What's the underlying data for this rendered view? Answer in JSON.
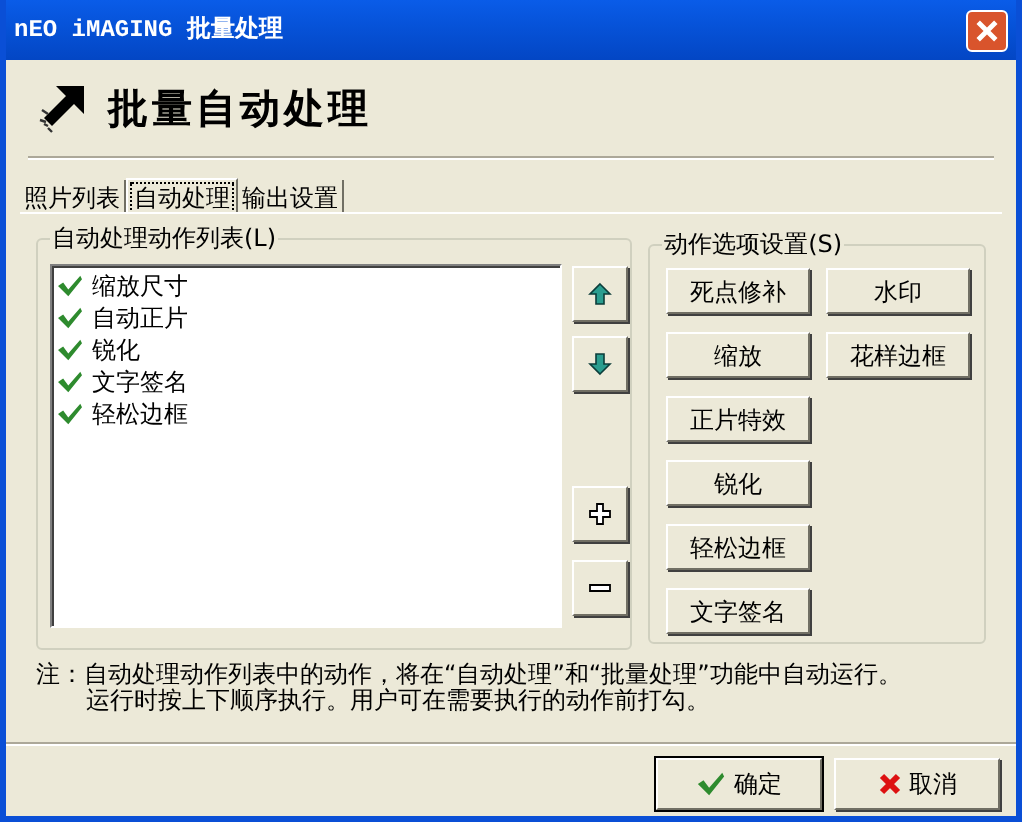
{
  "window": {
    "title": "nEO iMAGING 批量处理"
  },
  "header": {
    "title": "批量自动处理"
  },
  "tabs": [
    {
      "label": "照片列表",
      "selected": false
    },
    {
      "label": "自动处理",
      "selected": true
    },
    {
      "label": "输出设置",
      "selected": false
    }
  ],
  "action_list": {
    "title": "自动处理动作列表(L)",
    "items": [
      {
        "label": "缩放尺寸",
        "checked": true
      },
      {
        "label": "自动正片",
        "checked": true
      },
      {
        "label": "锐化",
        "checked": true
      },
      {
        "label": "文字签名",
        "checked": true
      },
      {
        "label": "轻松边框",
        "checked": true
      }
    ]
  },
  "list_buttons": [
    {
      "kind": "up"
    },
    {
      "kind": "down"
    },
    {
      "kind": "add"
    },
    {
      "kind": "remove"
    }
  ],
  "action_options": {
    "title": "动作选项设置(S)",
    "columns": [
      [
        "死点修补",
        "缩放",
        "正片特效",
        "锐化",
        "轻松边框",
        "文字签名"
      ],
      [
        "水印",
        "花样边框"
      ]
    ]
  },
  "note": {
    "lines": [
      "注：自动处理动作列表中的动作，将在“自动处理”和“批量处理”功能中自动运行。",
      "运行时按上下顺序执行。用户可在需要执行的动作前打勾。"
    ]
  },
  "buttons": [
    {
      "label": "确定",
      "kind": "ok"
    },
    {
      "label": "取消",
      "kind": "cancel"
    }
  ]
}
